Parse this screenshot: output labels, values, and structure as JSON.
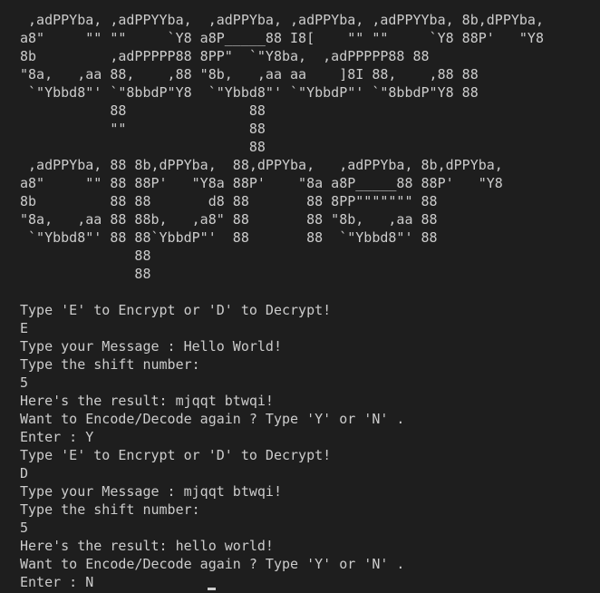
{
  "terminal": {
    "lines": [
      " ,adPPYba, ,adPPYYba,  ,adPPYba, ,adPPYba, ,adPPYYba, 8b,dPPYba,",
      "a8\"     \"\" \"\"     `Y8 a8P_____88 I8[    \"\" \"\"     `Y8 88P'   \"Y8",
      "8b         ,adPPPPP88 8PP\"  `\"Y8ba,  ,adPPPPP88 88",
      "\"8a,   ,aa 88,    ,88 \"8b,   ,aa aa    ]8I 88,    ,88 88",
      " `\"Ybbd8\"' `\"8bbdP\"Y8  `\"Ybbd8\"' `\"YbbdP\"' `\"8bbdP\"Y8 88",
      "           88               88",
      "           \"\"               88",
      "                            88",
      " ,adPPYba, 88 8b,dPPYba,  88,dPPYba,   ,adPPYba, 8b,dPPYba,",
      "a8\"     \"\" 88 88P'   \"Y8a 88P'    \"8a a8P_____88 88P'   \"Y8",
      "8b         88 88       d8 88       88 8PP\"\"\"\"\"\"\" 88",
      "\"8a,   ,aa 88 88b,   ,a8\" 88       88 \"8b,   ,aa 88",
      " `\"Ybbd8\"' 88 88`YbbdP\"'  88       88  `\"Ybbd8\"' 88",
      "              88",
      "              88",
      "",
      "Type 'E' to Encrypt or 'D' to Decrypt!",
      "E",
      "Type your Message : Hello World!",
      "Type the shift number:",
      "5",
      "Here's the result: mjqqt btwqi!",
      "Want to Encode/Decode again ? Type 'Y' or 'N' .",
      "Enter : Y",
      "Type 'E' to Encrypt or 'D' to Decrypt!",
      "D",
      "Type your Message : mjqqt btwqi!",
      "Type the shift number:",
      "5",
      "Here's the result: hello world!",
      "Want to Encode/Decode again ? Type 'Y' or 'N' .",
      "Enter : N"
    ]
  },
  "colors": {
    "background": "#1e1e1e",
    "text": "#cccccc"
  }
}
